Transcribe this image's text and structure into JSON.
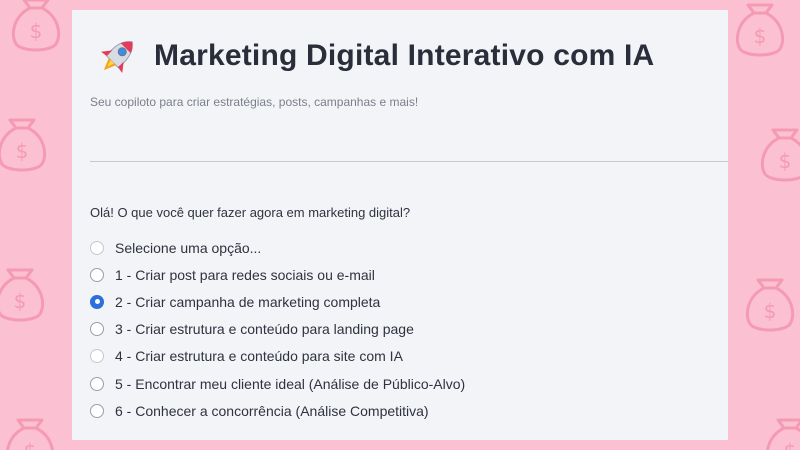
{
  "app": {
    "title": "Marketing Digital Interativo com IA",
    "subtitle": "Seu copiloto para criar estratégias, posts, campanhas e mais!"
  },
  "form": {
    "question": "Olá! O que você quer fazer agora em marketing digital?",
    "selected_index": 2,
    "options": [
      {
        "label": "Selecione uma opção..."
      },
      {
        "label": "1 - Criar post para redes sociais ou e-mail"
      },
      {
        "label": "2 - Criar campanha de marketing completa"
      },
      {
        "label": "3 - Criar estrutura e conteúdo para landing page"
      },
      {
        "label": "4 - Criar estrutura e conteúdo para site com IA"
      },
      {
        "label": "5 - Encontrar meu cliente ideal (Análise de Público-Alvo)"
      },
      {
        "label": "6 - Conhecer a concorrência (Análise Competitiva)"
      }
    ]
  },
  "icons": {
    "title_icon": "rocket-icon",
    "background_icon": "money-bag-icon"
  },
  "colors": {
    "background": "#fbc1d2",
    "pattern": "#f59ab4",
    "panel": "#f3f4f7",
    "accent": "#2a6fdb",
    "text": "#2a2d3a"
  }
}
